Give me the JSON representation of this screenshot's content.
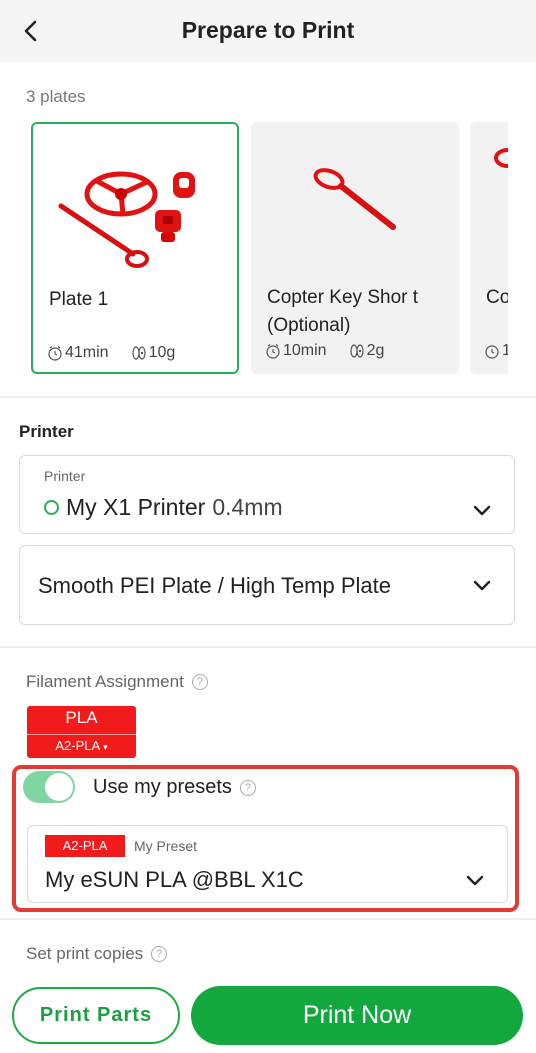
{
  "header": {
    "title": "Prepare to Print",
    "back_icon": "chevron-left-icon"
  },
  "plates_section": {
    "count_label": "3 plates",
    "plates": [
      {
        "name": "Plate 1",
        "time": "41min",
        "weight": "10g",
        "selected": true
      },
      {
        "name": "Copter Key Shor t (Optional)",
        "time": "10min",
        "weight": "2g",
        "selected": false
      },
      {
        "name": "Co (O",
        "time": "1",
        "weight": "",
        "selected": false
      }
    ]
  },
  "printer_section": {
    "label": "Printer",
    "printer_field": {
      "sub_label": "Printer",
      "name": "My X1 Printer",
      "nozzle": "0.4mm",
      "status_color": "#27ae60"
    },
    "plate_field": {
      "value": "Smooth PEI Plate / High Temp Plate"
    }
  },
  "filament_section": {
    "label": "Filament Assignment",
    "chip": {
      "type": "PLA",
      "preset": "A2-PLA",
      "color": "#f21b1b"
    },
    "use_presets": {
      "label": "Use my presets",
      "enabled": true
    },
    "preset_field": {
      "tag": "A2-PLA",
      "sub_label": "My Preset",
      "value": "My eSUN PLA @BBL X1C"
    }
  },
  "copies_section": {
    "label": "Set print copies"
  },
  "actions": {
    "print_parts": "Print Parts",
    "print_now": "Print Now"
  },
  "colors": {
    "accent": "#12a83e",
    "highlight": "#e53935",
    "filament": "#f21b1b"
  }
}
